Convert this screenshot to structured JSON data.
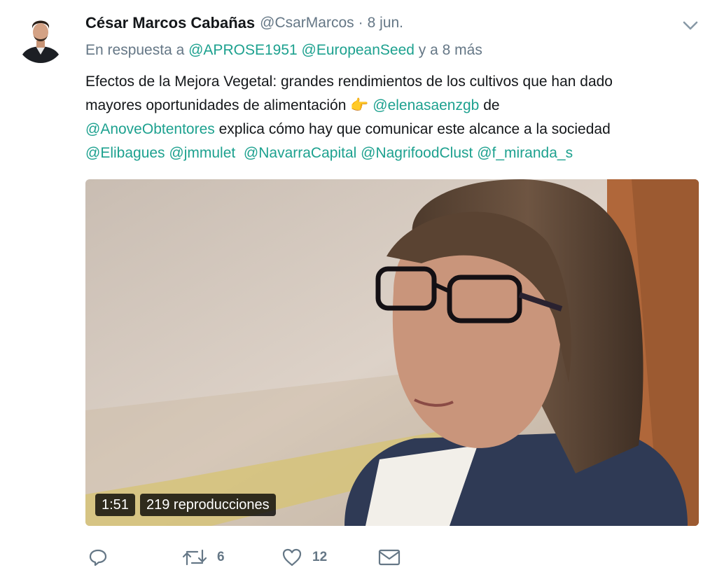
{
  "tweet": {
    "author_name": "César Marcos Cabañas",
    "author_handle": "@CsarMarcos",
    "separator": "·",
    "date": "8 jun.",
    "reply": {
      "prefix": "En respuesta a",
      "mention1": "@APROSE1951",
      "mention2": "@EuropeanSeed",
      "suffix": "y a 8 más"
    },
    "text": {
      "line1": "Efectos de la Mejora Vegetal: grandes rendimientos de los cultivos que han dado",
      "line2_a": "mayores oportunidades de alimentación",
      "line2_emoji": "👉",
      "line2_mention": "@elenasaenzgb",
      "line2_b": "de",
      "line3_mention": "@AnoveObtentores",
      "line3_b": "explica cómo hay que comunicar este alcance a la sociedad",
      "line4_mentions": [
        "@Elibagues",
        "@jmmulet",
        "@NavarraCapital",
        "@NagrifoodClust",
        "@f_miranda_s"
      ]
    },
    "video": {
      "duration": "1:51",
      "views": "219 reproducciones"
    },
    "actions": {
      "reply_icon": "reply-icon",
      "retweet_icon": "retweet-icon",
      "retweet_count": "6",
      "like_icon": "heart-icon",
      "like_count": "12",
      "dm_icon": "envelope-icon"
    }
  },
  "colors": {
    "mention": "#1da18f",
    "muted": "#657786",
    "text": "#14171a"
  }
}
